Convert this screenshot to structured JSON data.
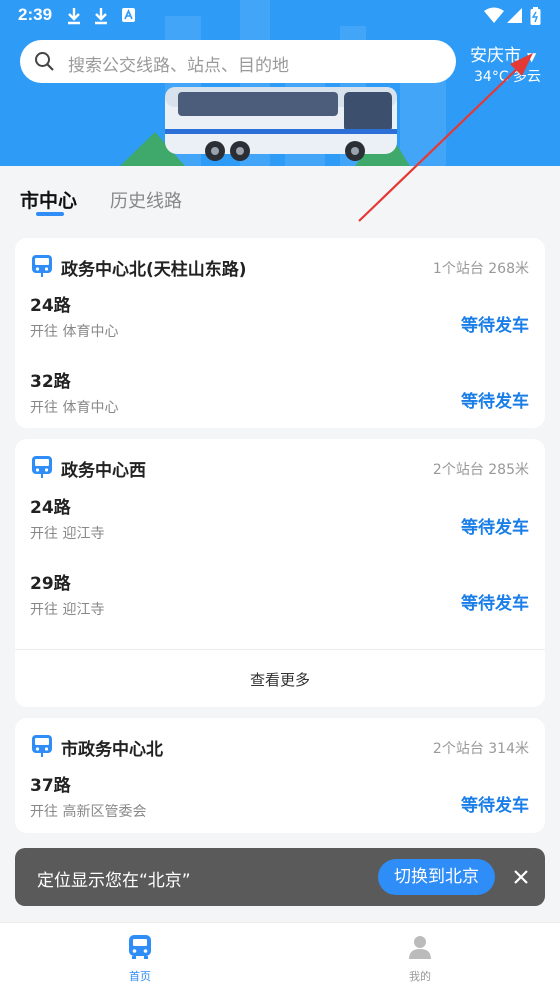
{
  "status_bar": {
    "time": "2:39"
  },
  "search": {
    "placeholder": "搜索公交线路、站点、目的地"
  },
  "location": {
    "city": "安庆市",
    "weather": "34°C 多云"
  },
  "tabs": [
    {
      "label": "市中心",
      "active": true
    },
    {
      "label": "历史线路",
      "active": false
    }
  ],
  "stops": [
    {
      "name": "政务中心北(天柱山东路)",
      "distance": "1个站台 268米",
      "routes": [
        {
          "name": "24路",
          "direction": "开往 体育中心",
          "status": "等待发车"
        },
        {
          "name": "32路",
          "direction": "开往 体育中心",
          "status": "等待发车"
        }
      ]
    },
    {
      "name": "政务中心西",
      "distance": "2个站台 285米",
      "routes": [
        {
          "name": "24路",
          "direction": "开往 迎江寺",
          "status": "等待发车"
        },
        {
          "name": "29路",
          "direction": "开往 迎江寺",
          "status": "等待发车"
        }
      ],
      "more_label": "查看更多"
    },
    {
      "name": "市政务中心北",
      "distance": "2个站台 314米",
      "routes": [
        {
          "name": "37路",
          "direction": "开往 高新区管委会",
          "status": "等待发车"
        }
      ]
    }
  ],
  "toast": {
    "message": "定位显示您在“北京”",
    "action": "切换到北京"
  },
  "bottom_nav": [
    {
      "label": "首页",
      "active": true
    },
    {
      "label": "我的",
      "active": false
    }
  ],
  "colors": {
    "primary": "#2e8df6",
    "hero_bg": "#2e9bf6",
    "arrow": "#e53935",
    "status_text": "#1a7ee8"
  }
}
